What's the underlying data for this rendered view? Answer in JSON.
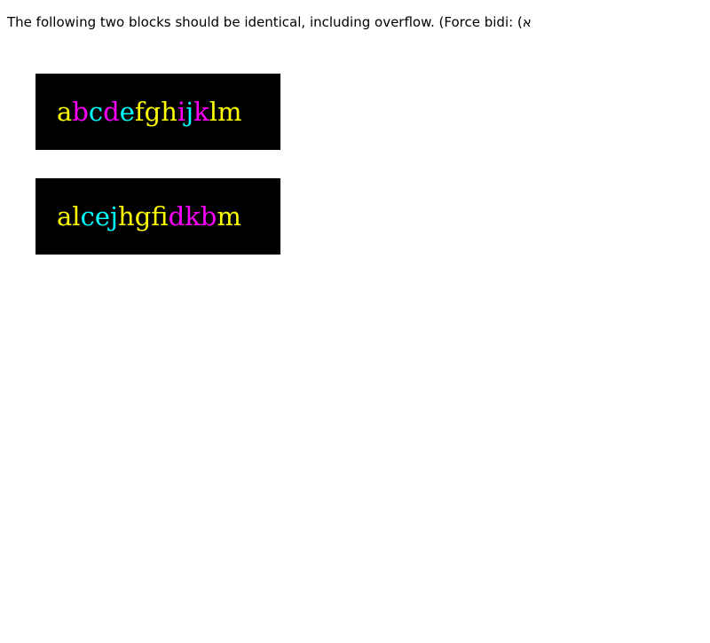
{
  "intro_text": "The following two blocks should be identical, including overflow. (Force bidi: (א",
  "colors": {
    "yellow": "#ffff00",
    "magenta": "#ff00ff",
    "cyan": "#00ffff",
    "block_background": "#000000"
  },
  "blocks": [
    {
      "glyphs": [
        {
          "char": "a",
          "color": "yellow"
        },
        {
          "char": "b",
          "color": "magenta"
        },
        {
          "char": "c",
          "color": "cyan"
        },
        {
          "char": "d",
          "color": "magenta"
        },
        {
          "char": "e",
          "color": "cyan"
        },
        {
          "char": "f",
          "color": "yellow"
        },
        {
          "char": "g",
          "color": "yellow"
        },
        {
          "char": "h",
          "color": "yellow"
        },
        {
          "char": "i",
          "color": "magenta"
        },
        {
          "char": "j",
          "color": "cyan"
        },
        {
          "char": "k",
          "color": "magenta"
        },
        {
          "char": "l",
          "color": "yellow"
        },
        {
          "char": "m",
          "color": "yellow"
        }
      ]
    },
    {
      "glyphs": [
        {
          "char": "a",
          "color": "yellow"
        },
        {
          "char": "l",
          "color": "yellow"
        },
        {
          "char": "c",
          "color": "cyan"
        },
        {
          "char": "e",
          "color": "cyan"
        },
        {
          "char": "j",
          "color": "cyan"
        },
        {
          "char": "h",
          "color": "yellow"
        },
        {
          "char": "g",
          "color": "yellow"
        },
        {
          "char": "f",
          "color": "yellow"
        },
        {
          "char": "i",
          "color": "magenta"
        },
        {
          "char": "d",
          "color": "magenta"
        },
        {
          "char": "k",
          "color": "magenta"
        },
        {
          "char": "b",
          "color": "magenta"
        },
        {
          "char": "m",
          "color": "yellow"
        }
      ]
    }
  ]
}
